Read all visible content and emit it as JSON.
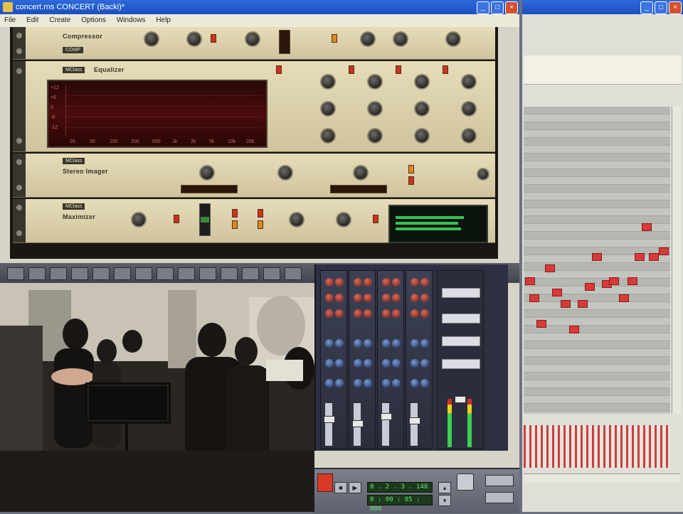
{
  "main_window": {
    "title": "concert.rns CONCERT (Backi)*",
    "controls": {
      "minimize": "_",
      "maximize": "□",
      "close": "×"
    }
  },
  "menu": [
    "File",
    "Edit",
    "Create",
    "Options",
    "Windows",
    "Help"
  ],
  "rack": {
    "devices": [
      {
        "name": "Compressor",
        "badge": "COMP"
      },
      {
        "name": "Equalizer",
        "badge": "MClass",
        "axis_labels": [
          "20",
          "50",
          "100",
          "200",
          "500",
          "1k",
          "2k",
          "5k",
          "10k",
          "20k"
        ],
        "db_labels": [
          "+12",
          "+6",
          "0",
          "-6",
          "-12"
        ]
      },
      {
        "name": "Stereo Imager",
        "badge": "MClass"
      },
      {
        "name": "Maximizer",
        "badge": "MClass"
      }
    ]
  },
  "transport": {
    "position": "0 . 2 . 3 . 148",
    "time": "0 : 00 : 05 : 000"
  },
  "sequencer_window": {
    "controls": {
      "minimize": "_",
      "maximize": "□",
      "close": "×"
    }
  }
}
